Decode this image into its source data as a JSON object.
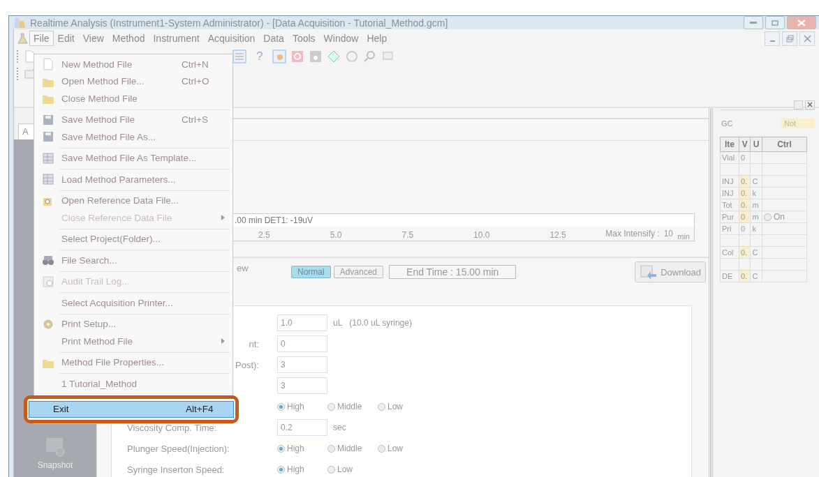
{
  "window": {
    "title": "Realtime Analysis (Instrument1-System Administrator) - [Data Acquisition - Tutorial_Method.gcm]"
  },
  "menubar": [
    {
      "label": "File",
      "selected": true
    },
    {
      "label": "Edit",
      "selected": false
    },
    {
      "label": "View",
      "selected": false
    },
    {
      "label": "Method",
      "selected": false
    },
    {
      "label": "Instrument",
      "selected": false
    },
    {
      "label": "Acquisition",
      "selected": false
    },
    {
      "label": "Data",
      "selected": false
    },
    {
      "label": "Tools",
      "selected": false
    },
    {
      "label": "Window",
      "selected": false
    },
    {
      "label": "Help",
      "selected": false
    }
  ],
  "toolbar": {
    "help_label": "?"
  },
  "file_menu": [
    {
      "kind": "item",
      "label": "New Method File",
      "shortcut": "Ctrl+N",
      "disabled": false,
      "submenu": false,
      "selected": false
    },
    {
      "kind": "item",
      "label": "Open Method File...",
      "shortcut": "Ctrl+O",
      "disabled": false,
      "submenu": false,
      "selected": false
    },
    {
      "kind": "item",
      "label": "Close Method File",
      "disabled": false,
      "submenu": false,
      "selected": false
    },
    {
      "kind": "separator"
    },
    {
      "kind": "item",
      "label": "Save Method File",
      "shortcut": "Ctrl+S",
      "disabled": false,
      "submenu": false,
      "selected": false
    },
    {
      "kind": "item",
      "label": "Save Method File As...",
      "disabled": false,
      "submenu": false,
      "selected": false
    },
    {
      "kind": "separator"
    },
    {
      "kind": "item",
      "label": "Save Method File As Template...",
      "disabled": false,
      "submenu": false,
      "selected": false
    },
    {
      "kind": "separator"
    },
    {
      "kind": "item",
      "label": "Load Method Parameters...",
      "disabled": false,
      "submenu": false,
      "selected": false
    },
    {
      "kind": "separator"
    },
    {
      "kind": "item",
      "label": "Open Reference Data File...",
      "disabled": false,
      "submenu": false,
      "selected": false
    },
    {
      "kind": "item",
      "label": "Close Reference Data File",
      "disabled": true,
      "submenu": true,
      "selected": false
    },
    {
      "kind": "separator"
    },
    {
      "kind": "item",
      "label": "Select Project(Folder)...",
      "disabled": false,
      "submenu": false,
      "selected": false
    },
    {
      "kind": "separator"
    },
    {
      "kind": "item",
      "label": "File Search...",
      "disabled": false,
      "submenu": false,
      "selected": false
    },
    {
      "kind": "separator"
    },
    {
      "kind": "item",
      "label": "Audit Trail Log...",
      "disabled": true,
      "submenu": false,
      "selected": false
    },
    {
      "kind": "separator"
    },
    {
      "kind": "item",
      "label": "Select Acquisition Printer...",
      "disabled": false,
      "submenu": false,
      "selected": false
    },
    {
      "kind": "separator"
    },
    {
      "kind": "item",
      "label": "Print Setup...",
      "disabled": false,
      "submenu": false,
      "selected": false
    },
    {
      "kind": "item",
      "label": "Print Method File",
      "disabled": false,
      "submenu": true,
      "selected": false
    },
    {
      "kind": "separator"
    },
    {
      "kind": "item",
      "label": "Method File Properties...",
      "disabled": false,
      "submenu": false,
      "selected": false
    },
    {
      "kind": "separator"
    },
    {
      "kind": "item",
      "label": "1 Tutorial_Method",
      "disabled": false,
      "submenu": false,
      "selected": false
    },
    {
      "kind": "item",
      "label": "Exit",
      "shortcut": "Alt+F4",
      "disabled": false,
      "submenu": false,
      "selected": true
    }
  ],
  "sidebar": {
    "tab": "A",
    "items": [
      {
        "label": "Snapshot"
      }
    ]
  },
  "chromatogram": {
    "status": ".00 min DET1: -19uV",
    "ticks": [
      "2.5",
      "5.0",
      "7.5",
      "10.0",
      "12.5"
    ],
    "unit": "min",
    "max_label": "Max Intensify :",
    "max_value": "10"
  },
  "view_bar": {
    "label": "ew",
    "modes": [
      {
        "label": "Normal",
        "selected": true
      },
      {
        "label": "Advanced",
        "selected": false
      }
    ],
    "end_time": "End Time : 15.00 min",
    "download": "Download"
  },
  "parameters": [
    {
      "kind": "field",
      "value": "1.0",
      "unit": "uL",
      "note": "(10.0 uL syringe)"
    },
    {
      "kind": "field",
      "label": "nt:",
      "clipped": true,
      "value": "0"
    },
    {
      "kind": "field",
      "label": "Post):",
      "clipped": true,
      "value": "3"
    },
    {
      "kind": "field",
      "value": "3"
    },
    {
      "kind": "radio",
      "options": [
        {
          "label": "High",
          "selected": true
        },
        {
          "label": "Middle",
          "selected": false
        },
        {
          "label": "Low",
          "selected": false
        }
      ]
    },
    {
      "kind": "field",
      "label": "Viscosity Comp. Time:",
      "value": "0.2",
      "unit": "sec"
    },
    {
      "kind": "radio",
      "label": "Plunger Speed(Injection):",
      "options": [
        {
          "label": "High",
          "selected": true
        },
        {
          "label": "Middle",
          "selected": false
        },
        {
          "label": "Low",
          "selected": false
        }
      ]
    },
    {
      "kind": "radio",
      "label": "Syringe Inserton Speed:",
      "options": [
        {
          "label": "High",
          "selected": true
        },
        {
          "label": "Low",
          "selected": false
        }
      ]
    }
  ],
  "monitor": {
    "label": "GC",
    "status": "Not",
    "columns": [
      "Ite",
      "V",
      "U",
      "Ctrl"
    ],
    "rows": [
      {
        "item": "Vial",
        "value": "0",
        "unit": "",
        "highlight": false
      },
      {
        "item": "",
        "value": "",
        "unit": "",
        "highlight": false
      },
      {
        "item": "INJ",
        "value": "0.",
        "unit": "C",
        "highlight": true
      },
      {
        "item": "INJ",
        "value": "0.",
        "unit": "k",
        "highlight": true
      },
      {
        "item": "Tot",
        "value": "0.",
        "unit": "m",
        "highlight": true
      },
      {
        "item": "Pur",
        "value": "0",
        "unit": "m",
        "highlight": true,
        "ctrl": "On",
        "ctrl_selected": false
      },
      {
        "item": "Pri",
        "value": "0",
        "unit": "k",
        "highlight": false
      },
      {
        "item": "",
        "value": "",
        "unit": "",
        "highlight": false
      },
      {
        "item": "Col",
        "value": "0.",
        "unit": "C",
        "highlight": true
      },
      {
        "item": "",
        "value": "",
        "unit": "",
        "highlight": false
      },
      {
        "item": "DE",
        "value": "0.",
        "unit": "C",
        "highlight": true
      }
    ]
  }
}
